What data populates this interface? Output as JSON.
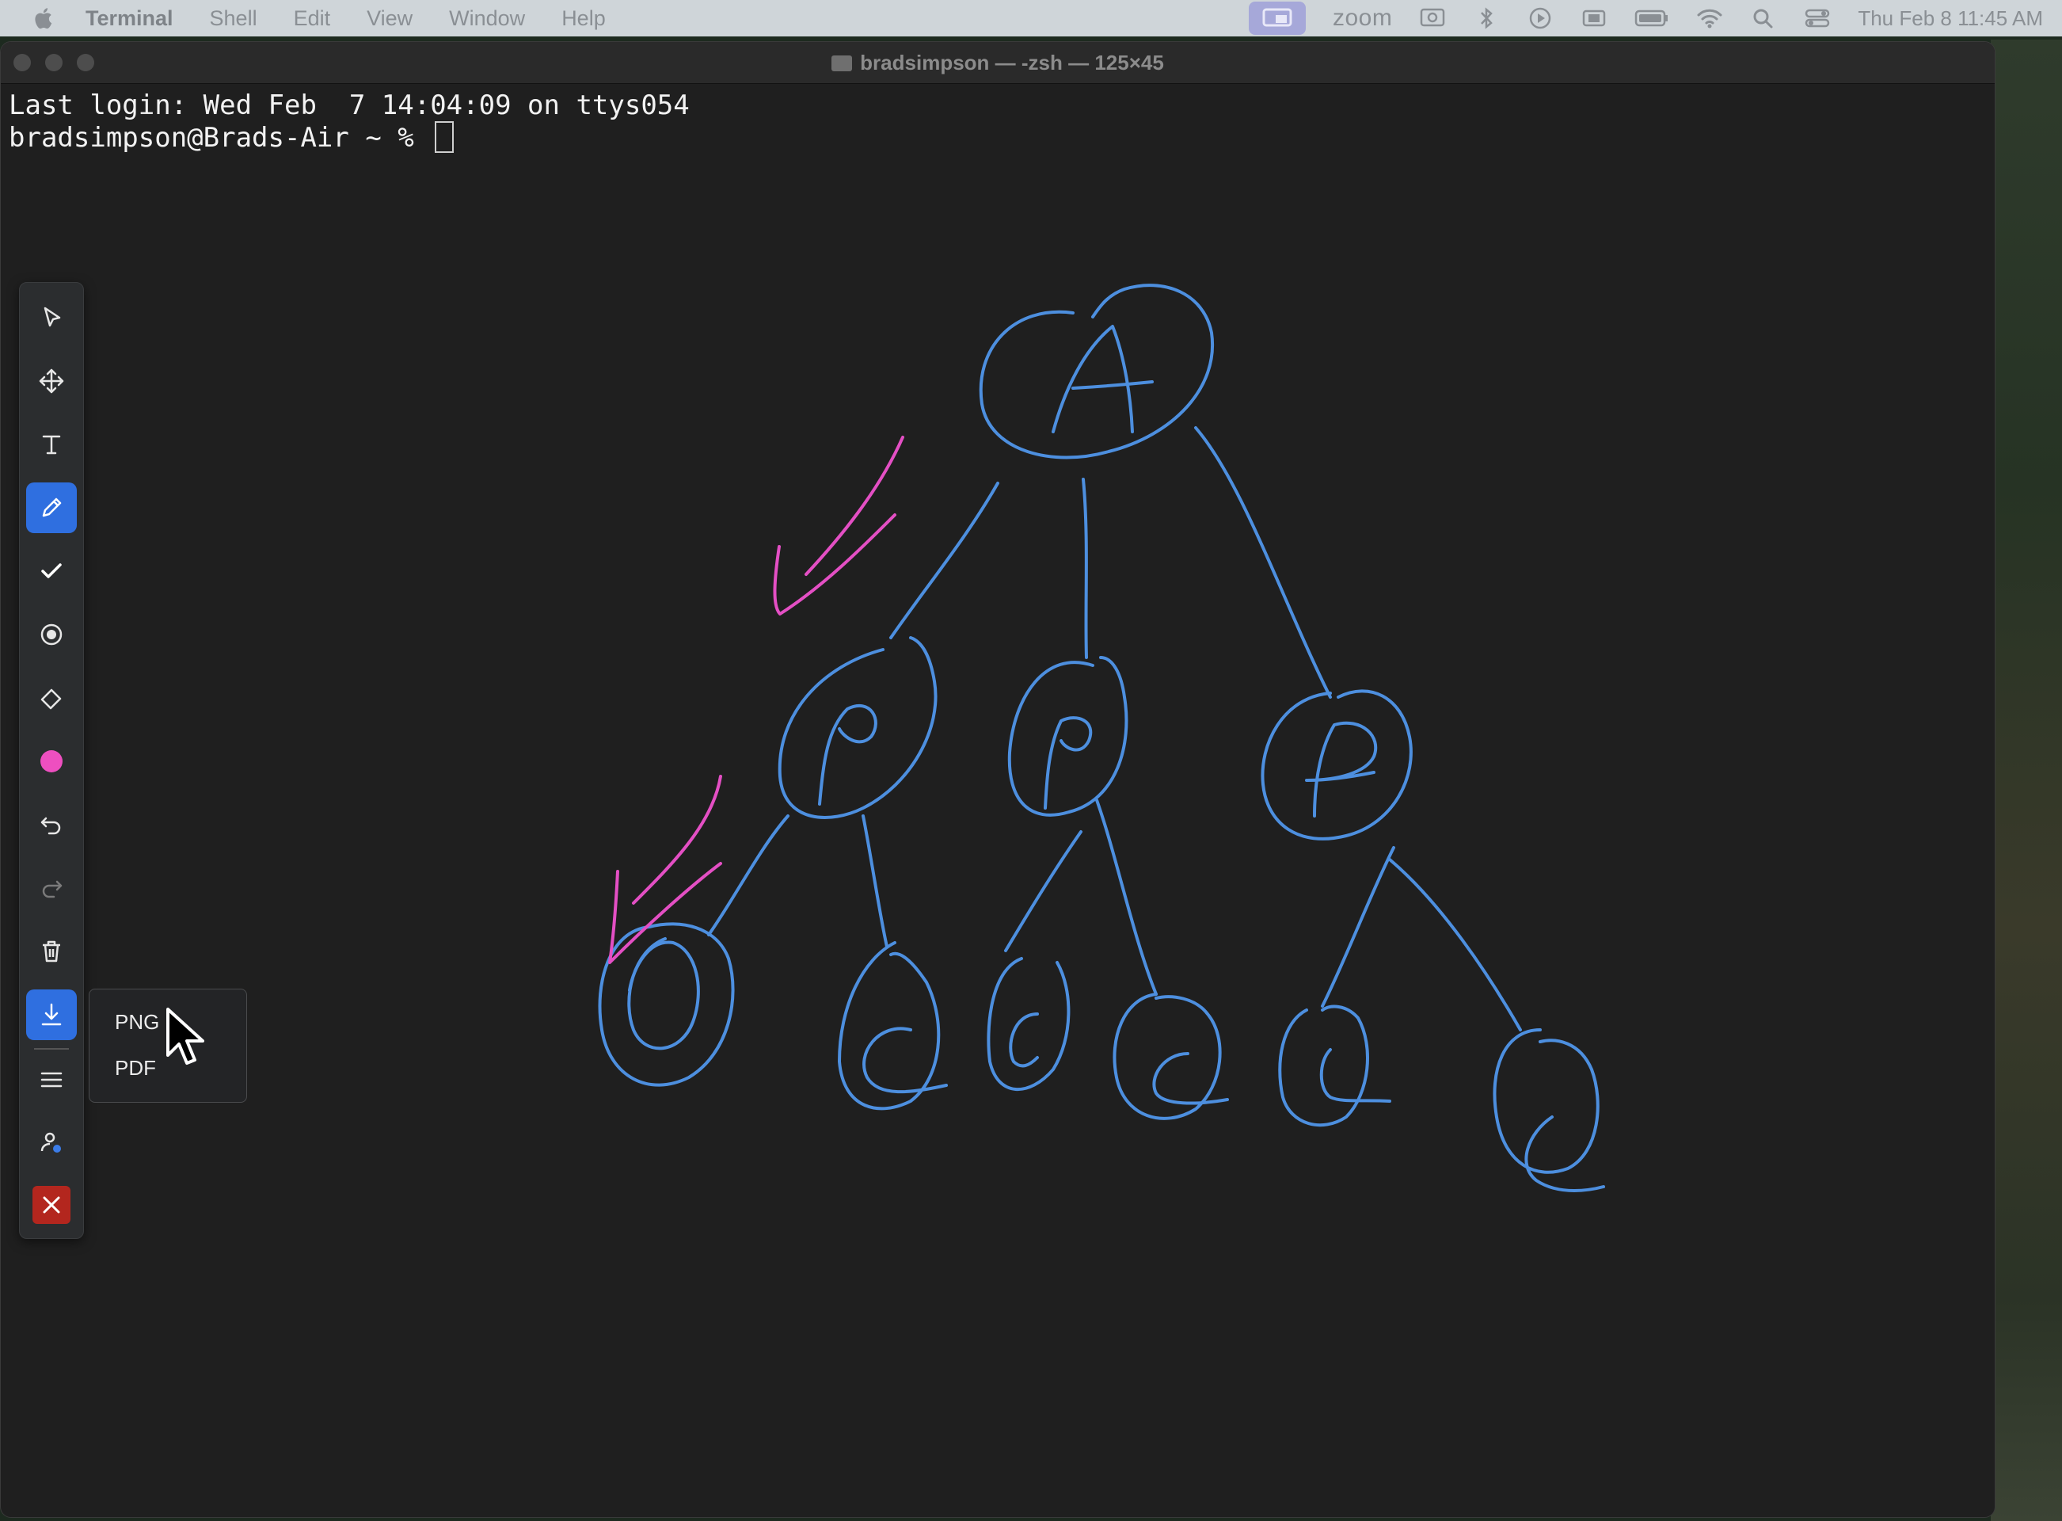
{
  "menubar": {
    "app_name": "Terminal",
    "items": [
      "Shell",
      "Edit",
      "View",
      "Window",
      "Help"
    ],
    "zoom_label": "zoom",
    "clock": "Thu Feb 8  11:45 AM"
  },
  "window": {
    "title": "bradsimpson — -zsh — 125×45",
    "lines": [
      "Last login: Wed Feb  7 14:04:09 on ttys054",
      "bradsimpson@Brads-Air ~ % "
    ]
  },
  "toolbar": {
    "tools": [
      "select",
      "move",
      "text",
      "pen",
      "checkmark",
      "spotlight",
      "eraser",
      "color",
      "undo",
      "redo",
      "delete",
      "download",
      "menu",
      "participants",
      "close"
    ],
    "active_tool": "pen",
    "active_color": "#ee4fc0"
  },
  "export_menu": {
    "options": [
      "PNG",
      "PDF"
    ]
  },
  "drawing": {
    "tree_nodes": [
      "A",
      "P",
      "P",
      "P",
      "O",
      "C",
      "C",
      "C",
      "C",
      "C"
    ],
    "stroke_color_primary": "#4d8fdf",
    "stroke_color_secondary": "#e44fc4"
  }
}
